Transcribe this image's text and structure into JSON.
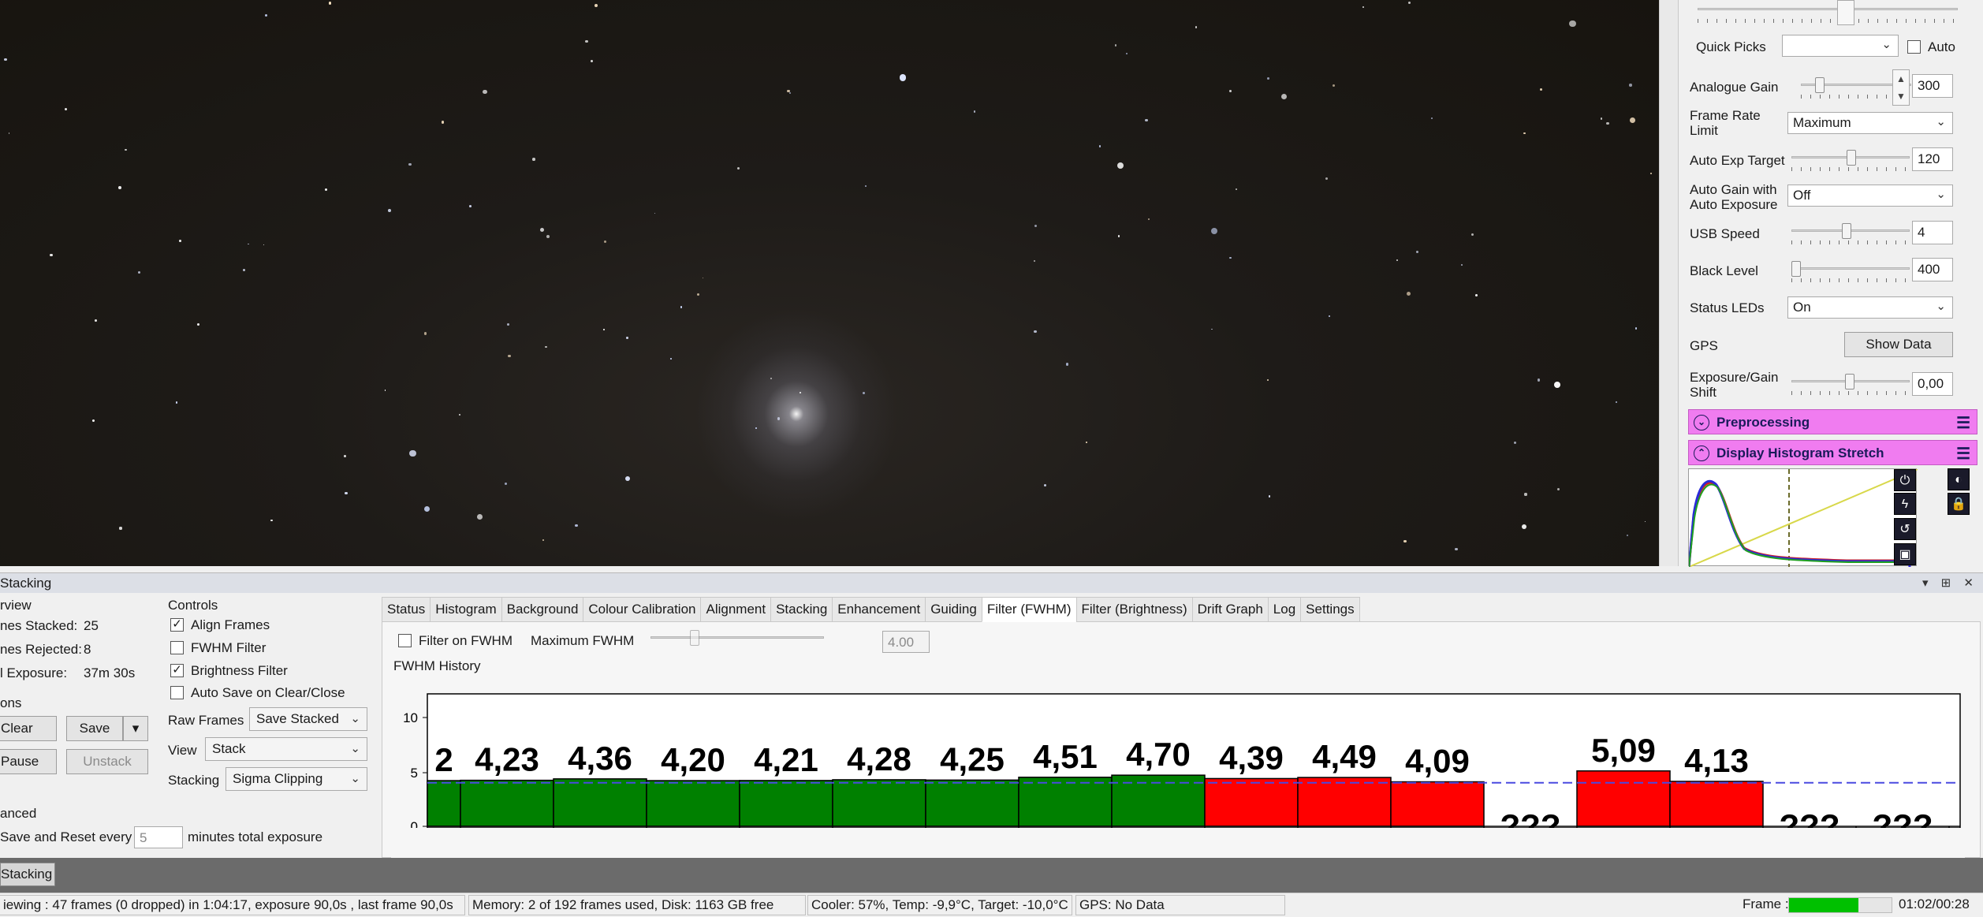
{
  "colors": {
    "preprocess_bar": "#f07cf0",
    "bar_pass": "#008000",
    "bar_reject": "#ff0000",
    "frame_progress": "#00c000",
    "threshold_line": "#4a4ae0"
  },
  "camera_controls": {
    "quick_picks_label": "Quick Picks",
    "auto_label": "Auto",
    "analogue_gain_label": "Analogue Gain",
    "analogue_gain_value": "300",
    "frame_rate_label": "Frame Rate Limit",
    "frame_rate_value": "Maximum",
    "auto_exp_label": "Auto Exp Target",
    "auto_exp_value": "120",
    "auto_gain_label": "Auto Gain with Auto Exposure",
    "auto_gain_value": "Off",
    "usb_speed_label": "USB Speed",
    "usb_speed_value": "4",
    "black_level_label": "Black Level",
    "black_level_value": "400",
    "status_leds_label": "Status LEDs",
    "status_leds_value": "On",
    "gps_label": "GPS",
    "gps_button": "Show Data",
    "exp_gain_shift_label": "Exposure/Gain Shift",
    "exp_gain_shift_value": "0,00"
  },
  "sections": {
    "preprocessing": "Preprocessing",
    "display_histogram": "Display Histogram Stretch"
  },
  "stacking": {
    "title": "Stacking",
    "overview_title": "rview",
    "frames_stacked_label": "nes Stacked:",
    "frames_stacked_value": "25",
    "frames_rejected_label": "nes Rejected:",
    "frames_rejected_value": "8",
    "total_exposure_label": "l Exposure:",
    "total_exposure_value": "37m 30s",
    "actions_title": "ons",
    "clear_button": "Clear",
    "save_button": "Save",
    "pause_button": "Pause",
    "unstack_button": "Unstack",
    "advanced_title": "anced",
    "save_reset_label": "Save and Reset every",
    "save_reset_value": "5",
    "save_reset_suffix": "minutes total exposure",
    "controls_title": "Controls",
    "align_frames": "Align Frames",
    "fwhm_filter": "FWHM Filter",
    "brightness_filter": "Brightness Filter",
    "auto_save": "Auto Save on Clear/Close",
    "raw_frames_label": "Raw Frames",
    "raw_frames_value": "Save Stacked",
    "view_label": "View",
    "view_value": "Stack",
    "stacking_label": "Stacking",
    "stacking_value": "Sigma Clipping"
  },
  "tabs": [
    "Status",
    "Histogram",
    "Background",
    "Colour Calibration",
    "Alignment",
    "Stacking",
    "Enhancement",
    "Guiding",
    "Filter (FWHM)",
    "Filter (Brightness)",
    "Drift Graph",
    "Log",
    "Settings"
  ],
  "fwhm_filter": {
    "filter_on_label": "Filter on FWHM",
    "max_fwhm_label": "Maximum FWHM",
    "max_fwhm_value": "4.00",
    "history_title": "FWHM History"
  },
  "chart_data": {
    "type": "bar",
    "title": "FWHM History",
    "ylim": [
      0,
      12
    ],
    "yticks": [
      "10",
      "5",
      "0"
    ],
    "ytick_values": [
      10,
      5,
      0
    ],
    "threshold": 4.0,
    "bars": [
      {
        "label": "2",
        "value": 4.2,
        "status": "pass"
      },
      {
        "label": "4,23",
        "value": 4.23,
        "status": "pass"
      },
      {
        "label": "4,36",
        "value": 4.36,
        "status": "pass"
      },
      {
        "label": "4,20",
        "value": 4.2,
        "status": "pass"
      },
      {
        "label": "4,21",
        "value": 4.21,
        "status": "pass"
      },
      {
        "label": "4,28",
        "value": 4.28,
        "status": "pass"
      },
      {
        "label": "4,25",
        "value": 4.25,
        "status": "pass"
      },
      {
        "label": "4,51",
        "value": 4.51,
        "status": "pass"
      },
      {
        "label": "4,70",
        "value": 4.7,
        "status": "pass"
      },
      {
        "label": "4,39",
        "value": 4.39,
        "status": "reject"
      },
      {
        "label": "4,49",
        "value": 4.49,
        "status": "reject"
      },
      {
        "label": "4,09",
        "value": 4.09,
        "status": "reject"
      },
      {
        "label": "???",
        "value": 0,
        "status": "unknown"
      },
      {
        "label": "5,09",
        "value": 5.09,
        "status": "reject"
      },
      {
        "label": "4,13",
        "value": 4.13,
        "status": "reject"
      },
      {
        "label": "???",
        "value": 0,
        "status": "unknown"
      },
      {
        "label": "???",
        "value": 0,
        "status": "unknown"
      }
    ],
    "grid": false
  },
  "tool_strip": {
    "stacking_tab": "Stacking"
  },
  "status_bar": {
    "viewing": "iewing : 47 frames (0 dropped) in 1:04:17, exposure 90,0s , last frame 90,0s",
    "memory": "Memory: 2 of 192 frames used, Disk: 1163 GB free",
    "cooler": "Cooler: 57%, Temp: -9,9°C, Target: -10,0°C",
    "gps": "GPS: No Data",
    "frame_label": "Frame :",
    "frame_progress": 0.68,
    "time": "01:02/00:28"
  }
}
